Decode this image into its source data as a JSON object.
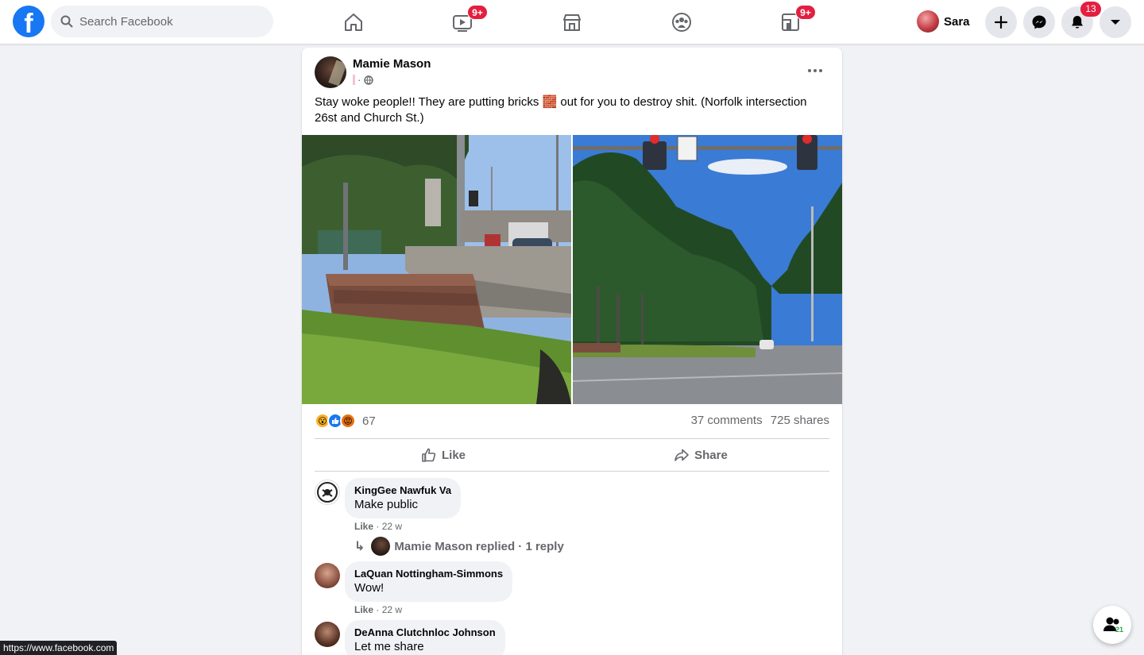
{
  "search": {
    "placeholder": "Search Facebook"
  },
  "nav": {
    "watch_badge": "9+",
    "gaming_badge": "9+"
  },
  "profile": {
    "name": "Sara"
  },
  "notifications": {
    "count": "13"
  },
  "post": {
    "author": "Mamie Mason",
    "text": "Stay woke people!! They are putting bricks 🧱 out for you to destroy shit. (Norfolk intersection 26st and Church St.)",
    "reaction_count": "67",
    "comments_count": "37 comments",
    "shares_count": "725 shares",
    "like_label": "Like",
    "share_label": "Share"
  },
  "comments": [
    {
      "name": "KingGee Nawfuk Va",
      "text": "Make public",
      "like": "Like",
      "time": "22 w"
    },
    {
      "name": "LaQuan Nottingham-Simmons",
      "text": "Wow!",
      "like": "Like",
      "time": "22 w"
    },
    {
      "name": "DeAnna Clutchnloc Johnson",
      "text": "Let me share"
    }
  ],
  "reply_summary": {
    "text": "Mamie Mason replied · 1 reply"
  },
  "status_url": "https://www.facebook.com",
  "contacts": {
    "count": "21"
  },
  "colors": {
    "brand": "#1877f2",
    "badge": "#e41e3f",
    "background": "#f0f2f5"
  }
}
